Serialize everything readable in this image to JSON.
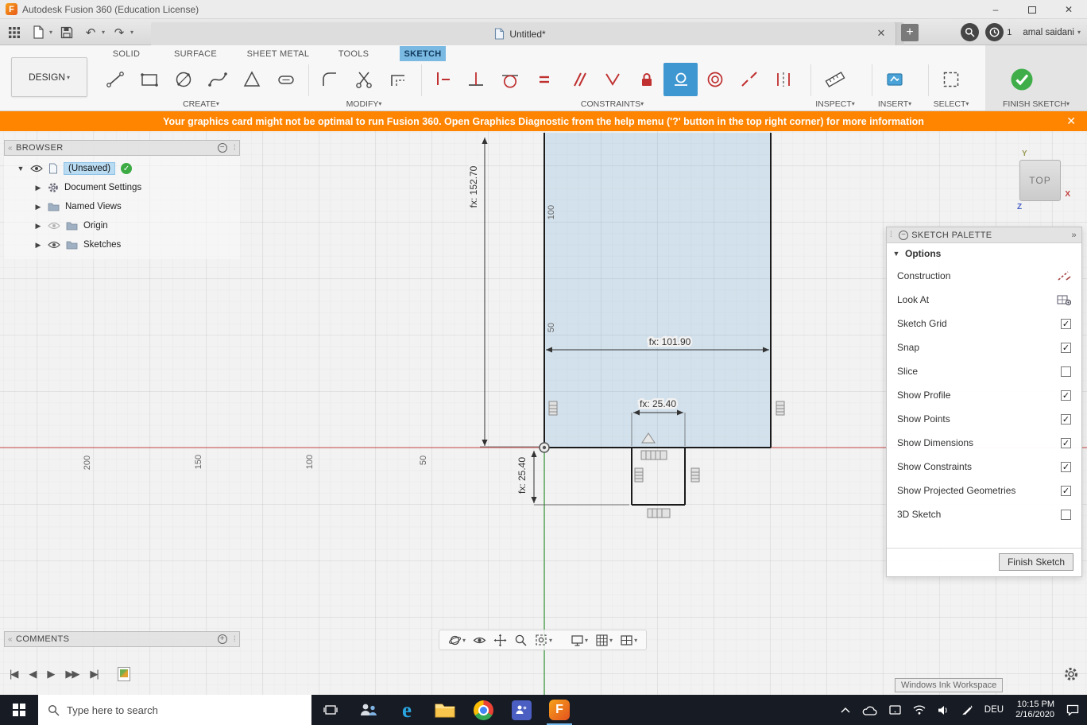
{
  "window": {
    "title": "Autodesk Fusion 360 (Education License)"
  },
  "qat": {
    "tab_title": "Untitled*",
    "badge_count": "1",
    "user_name": "amal saidani"
  },
  "ribbon": {
    "workspace_label": "DESIGN",
    "tabs": [
      {
        "label": "SOLID",
        "active": false
      },
      {
        "label": "SURFACE",
        "active": false
      },
      {
        "label": "SHEET METAL",
        "active": false
      },
      {
        "label": "TOOLS",
        "active": false
      },
      {
        "label": "SKETCH",
        "active": true
      }
    ],
    "groups": [
      {
        "label": "CREATE"
      },
      {
        "label": "MODIFY"
      },
      {
        "label": "CONSTRAINTS"
      },
      {
        "label": "INSPECT"
      },
      {
        "label": "INSERT"
      },
      {
        "label": "SELECT"
      },
      {
        "label": "FINISH SKETCH"
      }
    ],
    "create_tools": [
      "line-icon",
      "rectangle-icon",
      "circle-icon",
      "spline-icon",
      "polygon-icon",
      "slot-icon"
    ],
    "modify_tools": [
      "fillet-icon",
      "trim-icon",
      "offset-icon"
    ],
    "constraint_tools": [
      "horizontal-vertical-icon",
      "perpendicular-icon",
      "tangent-icon",
      "equal-icon",
      "parallel-icon",
      "symmetry-v-icon",
      "fix-lock-icon",
      "midpoint-icon-selected",
      "concentric-icon",
      "collinear-icon",
      "symmetry-icon"
    ],
    "colors": {
      "active_tab_bg": "#79b9e2",
      "selected_tool_bg": "#3f97d1",
      "finish_green": "#3fae49"
    }
  },
  "banner": {
    "text": "Your graphics card might not be optimal to run Fusion 360. Open Graphics Diagnostic from the help menu ('?' button in the top right corner) for more information"
  },
  "browser": {
    "title": "BROWSER",
    "root_label": "(Unsaved)",
    "items": [
      {
        "label": "Document Settings",
        "icon": "gear-icon"
      },
      {
        "label": "Named Views",
        "icon": "folder-icon"
      },
      {
        "label": "Origin",
        "icon": "folder-icon",
        "visibility": "hidden"
      },
      {
        "label": "Sketches",
        "icon": "folder-icon",
        "visibility": "visible"
      }
    ]
  },
  "comments": {
    "title": "COMMENTS"
  },
  "canvas": {
    "dim_height": "fx: 152.70",
    "dim_width": "fx: 101.90",
    "dim_slot_width": "fx: 25.40",
    "dim_slot_height": "fx: 25.40",
    "h_ruler": [
      "200",
      "150",
      "100",
      "50"
    ],
    "v_ruler": [
      "100",
      "50"
    ],
    "viewcube": {
      "face": "TOP",
      "axis_y": "Y",
      "axis_x": "X",
      "axis_z": "Z"
    }
  },
  "palette": {
    "title": "SKETCH PALETTE",
    "section_label": "Options",
    "options": [
      {
        "label": "Construction",
        "control": "icon",
        "icon": "construction-icon"
      },
      {
        "label": "Look At",
        "control": "icon",
        "icon": "look-at-icon"
      },
      {
        "label": "Sketch Grid",
        "control": "checkbox",
        "checked": true
      },
      {
        "label": "Snap",
        "control": "checkbox",
        "checked": true
      },
      {
        "label": "Slice",
        "control": "checkbox",
        "checked": false
      },
      {
        "label": "Show Profile",
        "control": "checkbox",
        "checked": true
      },
      {
        "label": "Show Points",
        "control": "checkbox",
        "checked": true
      },
      {
        "label": "Show Dimensions",
        "control": "checkbox",
        "checked": true
      },
      {
        "label": "Show Constraints",
        "control": "checkbox",
        "checked": true
      },
      {
        "label": "Show Projected Geometries",
        "control": "checkbox",
        "checked": true
      },
      {
        "label": "3D Sketch",
        "control": "checkbox",
        "checked": false
      }
    ],
    "finish_button_label": "Finish Sketch"
  },
  "tooltip": {
    "text": "Windows Ink Workspace"
  },
  "taskbar": {
    "search_placeholder": "Type here to search",
    "language": "DEU",
    "time": "10:15 PM",
    "date": "2/16/2020"
  }
}
